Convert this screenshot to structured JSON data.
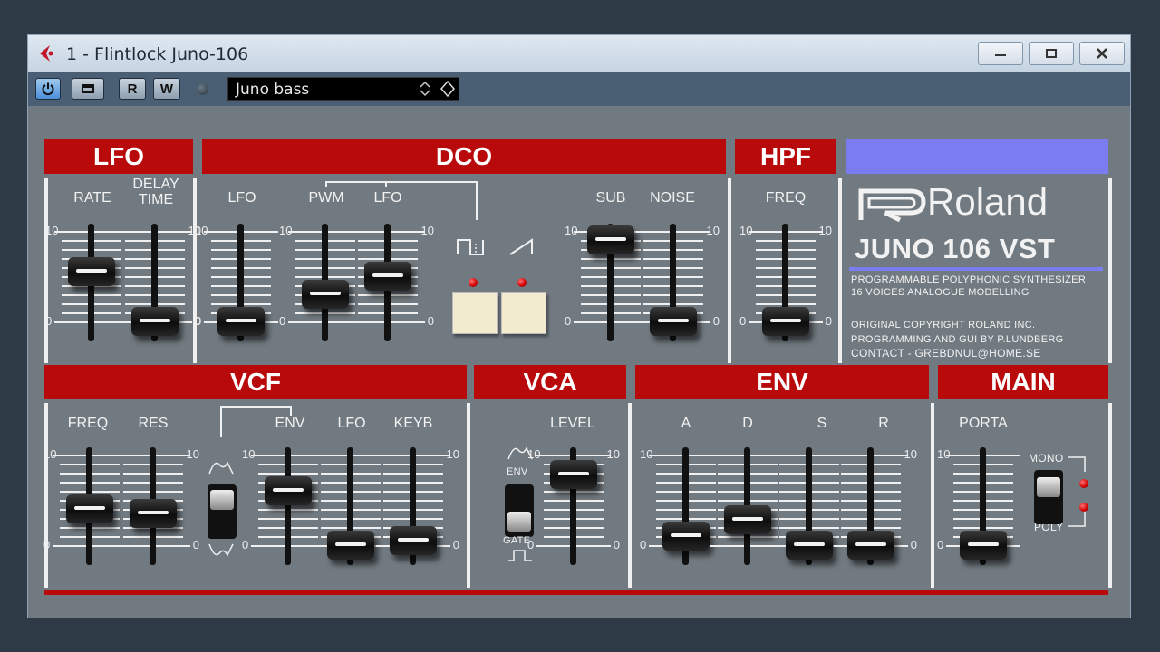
{
  "window": {
    "title": "1 - Flintlock Juno-106"
  },
  "toolbar": {
    "r_label": "R",
    "w_label": "W",
    "preset": "Juno bass"
  },
  "sections": {
    "lfo": "LFO",
    "dco": "DCO",
    "hpf": "HPF",
    "vcf": "VCF",
    "vca": "VCA",
    "env": "ENV",
    "main": "MAIN"
  },
  "labels": {
    "lfo_rate": "RATE",
    "lfo_delay": "DELAY\nTIME",
    "dco_lfo": "LFO",
    "dco_pwm": "PWM",
    "dco_pwm_lfo": "LFO",
    "dco_sub": "SUB",
    "dco_noise": "NOISE",
    "hpf_freq": "FREQ",
    "vcf_freq": "FREQ",
    "vcf_res": "RES",
    "vcf_env": "ENV",
    "vcf_lfo": "LFO",
    "vcf_keyb": "KEYB",
    "vca_level": "LEVEL",
    "vca_env": "ENV",
    "vca_gate": "GATE",
    "env_a": "A",
    "env_d": "D",
    "env_s": "S",
    "env_r": "R",
    "main_porta": "PORTA",
    "main_mono": "MONO",
    "main_poly": "POLY",
    "scale_max": "10",
    "scale_min": "0"
  },
  "sliders": {
    "lfo_rate": 0.55,
    "lfo_delay": 0.0,
    "dco_lfo": 0.0,
    "dco_pwm": 0.3,
    "dco_pwm_lfo": 0.5,
    "dco_sub": 0.9,
    "dco_noise": 0.0,
    "hpf_freq": 0.0,
    "vcf_freq": 0.4,
    "vcf_res": 0.35,
    "vcf_env": 0.6,
    "vcf_lfo": 0.0,
    "vcf_keyb": 0.05,
    "vca_level": 0.78,
    "env_a": 0.1,
    "env_d": 0.28,
    "env_s": 0.0,
    "env_r": 0.0,
    "main_porta": 0.0
  },
  "brand": {
    "logo": "Roland",
    "model": "JUNO 106 VST",
    "line1": "PROGRAMMABLE POLYPHONIC SYNTHESIZER",
    "line2": "16 VOICES ANALOGUE MODELLING",
    "line3": "ORIGINAL COPYRIGHT ROLAND INC.",
    "line4": "PROGRAMMING AND GUI BY P.LUNDBERG",
    "line5": "CONTACT - GREBDNUL@HOME.SE"
  },
  "colors": {
    "header_red": "#b80a0a",
    "panel_gray": "#717a80",
    "accent_blue": "#7a7cf0"
  }
}
